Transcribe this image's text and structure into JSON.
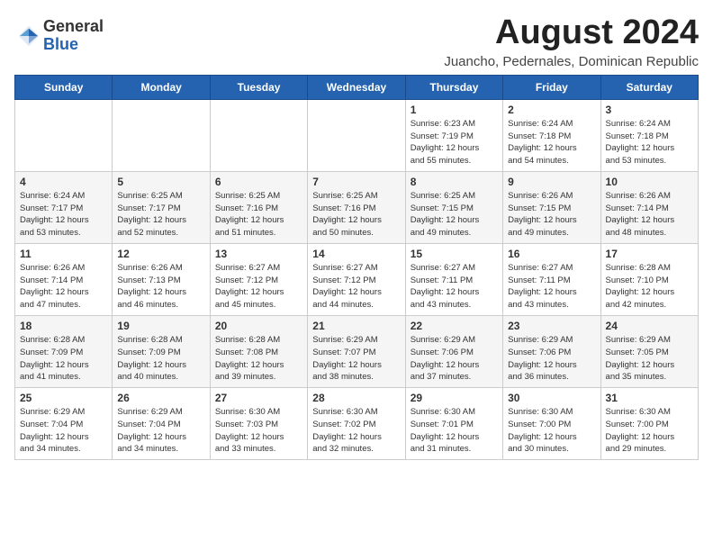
{
  "logo": {
    "general": "General",
    "blue": "Blue"
  },
  "title": "August 2024",
  "subtitle": "Juancho, Pedernales, Dominican Republic",
  "days_of_week": [
    "Sunday",
    "Monday",
    "Tuesday",
    "Wednesday",
    "Thursday",
    "Friday",
    "Saturday"
  ],
  "weeks": [
    [
      {
        "day": "",
        "info": ""
      },
      {
        "day": "",
        "info": ""
      },
      {
        "day": "",
        "info": ""
      },
      {
        "day": "",
        "info": ""
      },
      {
        "day": "1",
        "info": "Sunrise: 6:23 AM\nSunset: 7:19 PM\nDaylight: 12 hours\nand 55 minutes."
      },
      {
        "day": "2",
        "info": "Sunrise: 6:24 AM\nSunset: 7:18 PM\nDaylight: 12 hours\nand 54 minutes."
      },
      {
        "day": "3",
        "info": "Sunrise: 6:24 AM\nSunset: 7:18 PM\nDaylight: 12 hours\nand 53 minutes."
      }
    ],
    [
      {
        "day": "4",
        "info": "Sunrise: 6:24 AM\nSunset: 7:17 PM\nDaylight: 12 hours\nand 53 minutes."
      },
      {
        "day": "5",
        "info": "Sunrise: 6:25 AM\nSunset: 7:17 PM\nDaylight: 12 hours\nand 52 minutes."
      },
      {
        "day": "6",
        "info": "Sunrise: 6:25 AM\nSunset: 7:16 PM\nDaylight: 12 hours\nand 51 minutes."
      },
      {
        "day": "7",
        "info": "Sunrise: 6:25 AM\nSunset: 7:16 PM\nDaylight: 12 hours\nand 50 minutes."
      },
      {
        "day": "8",
        "info": "Sunrise: 6:25 AM\nSunset: 7:15 PM\nDaylight: 12 hours\nand 49 minutes."
      },
      {
        "day": "9",
        "info": "Sunrise: 6:26 AM\nSunset: 7:15 PM\nDaylight: 12 hours\nand 49 minutes."
      },
      {
        "day": "10",
        "info": "Sunrise: 6:26 AM\nSunset: 7:14 PM\nDaylight: 12 hours\nand 48 minutes."
      }
    ],
    [
      {
        "day": "11",
        "info": "Sunrise: 6:26 AM\nSunset: 7:14 PM\nDaylight: 12 hours\nand 47 minutes."
      },
      {
        "day": "12",
        "info": "Sunrise: 6:26 AM\nSunset: 7:13 PM\nDaylight: 12 hours\nand 46 minutes."
      },
      {
        "day": "13",
        "info": "Sunrise: 6:27 AM\nSunset: 7:12 PM\nDaylight: 12 hours\nand 45 minutes."
      },
      {
        "day": "14",
        "info": "Sunrise: 6:27 AM\nSunset: 7:12 PM\nDaylight: 12 hours\nand 44 minutes."
      },
      {
        "day": "15",
        "info": "Sunrise: 6:27 AM\nSunset: 7:11 PM\nDaylight: 12 hours\nand 43 minutes."
      },
      {
        "day": "16",
        "info": "Sunrise: 6:27 AM\nSunset: 7:11 PM\nDaylight: 12 hours\nand 43 minutes."
      },
      {
        "day": "17",
        "info": "Sunrise: 6:28 AM\nSunset: 7:10 PM\nDaylight: 12 hours\nand 42 minutes."
      }
    ],
    [
      {
        "day": "18",
        "info": "Sunrise: 6:28 AM\nSunset: 7:09 PM\nDaylight: 12 hours\nand 41 minutes."
      },
      {
        "day": "19",
        "info": "Sunrise: 6:28 AM\nSunset: 7:09 PM\nDaylight: 12 hours\nand 40 minutes."
      },
      {
        "day": "20",
        "info": "Sunrise: 6:28 AM\nSunset: 7:08 PM\nDaylight: 12 hours\nand 39 minutes."
      },
      {
        "day": "21",
        "info": "Sunrise: 6:29 AM\nSunset: 7:07 PM\nDaylight: 12 hours\nand 38 minutes."
      },
      {
        "day": "22",
        "info": "Sunrise: 6:29 AM\nSunset: 7:06 PM\nDaylight: 12 hours\nand 37 minutes."
      },
      {
        "day": "23",
        "info": "Sunrise: 6:29 AM\nSunset: 7:06 PM\nDaylight: 12 hours\nand 36 minutes."
      },
      {
        "day": "24",
        "info": "Sunrise: 6:29 AM\nSunset: 7:05 PM\nDaylight: 12 hours\nand 35 minutes."
      }
    ],
    [
      {
        "day": "25",
        "info": "Sunrise: 6:29 AM\nSunset: 7:04 PM\nDaylight: 12 hours\nand 34 minutes."
      },
      {
        "day": "26",
        "info": "Sunrise: 6:29 AM\nSunset: 7:04 PM\nDaylight: 12 hours\nand 34 minutes."
      },
      {
        "day": "27",
        "info": "Sunrise: 6:30 AM\nSunset: 7:03 PM\nDaylight: 12 hours\nand 33 minutes."
      },
      {
        "day": "28",
        "info": "Sunrise: 6:30 AM\nSunset: 7:02 PM\nDaylight: 12 hours\nand 32 minutes."
      },
      {
        "day": "29",
        "info": "Sunrise: 6:30 AM\nSunset: 7:01 PM\nDaylight: 12 hours\nand 31 minutes."
      },
      {
        "day": "30",
        "info": "Sunrise: 6:30 AM\nSunset: 7:00 PM\nDaylight: 12 hours\nand 30 minutes."
      },
      {
        "day": "31",
        "info": "Sunrise: 6:30 AM\nSunset: 7:00 PM\nDaylight: 12 hours\nand 29 minutes."
      }
    ]
  ]
}
